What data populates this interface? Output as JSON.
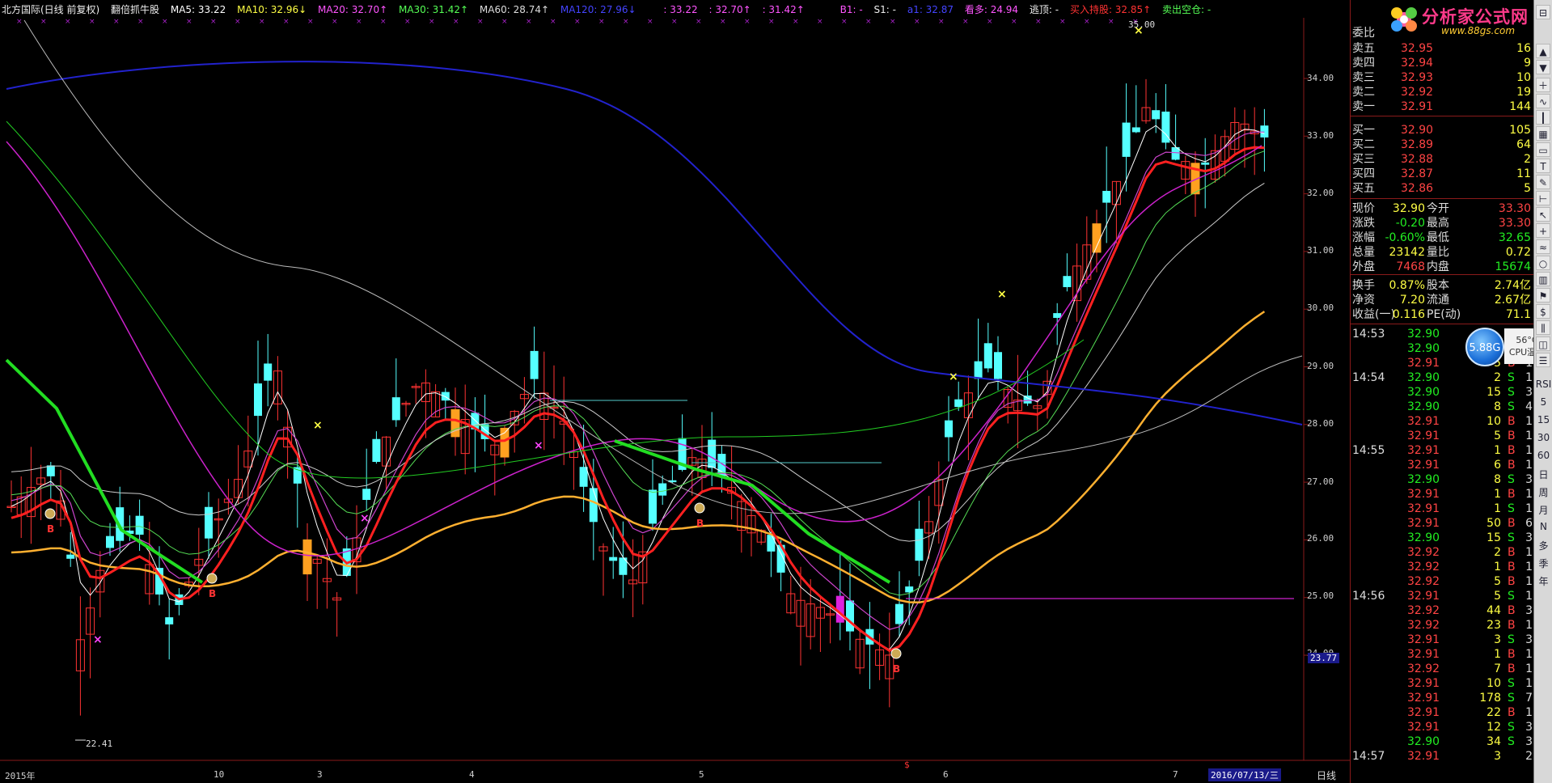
{
  "legend": {
    "title": "北方国际(日线 前复权)",
    "indicator": "翻倍抓牛股",
    "ma5": "MA5: 33.22",
    "ma10": "MA10: 32.96↓",
    "ma20": "MA20: 32.70↑",
    "ma30": "MA30: 31.42↑",
    "ma60": "MA60: 28.74↑",
    "ma120": "MA120: 27.96↓",
    "v1": ": 33.22",
    "v2": ": 32.70↑",
    "v3": ": 31.42↑",
    "b1": "B1: -",
    "s1": "S1: -",
    "a1": "a1: 32.87",
    "kanduo": "看多: 24.94",
    "taoding": "逃顶: -",
    "mairu": "买入持股: 32.85↑",
    "maichu": "卖出空仓: -"
  },
  "colors": {
    "ma5": "#ffffff",
    "ma10": "#ffff00",
    "ma20": "#ff44ff",
    "ma30": "#44ff44",
    "ma60": "#dddddd",
    "ma120": "#2222cc",
    "up": "#ff3333",
    "down": "#55ffff",
    "red_line": "#ff2020",
    "green_line": "#22dd22",
    "orange_line": "#ffb030",
    "magenta": "#dd22dd"
  },
  "price_axis": [
    "34.00",
    "33.00",
    "32.00",
    "31.00",
    "30.00",
    "29.00",
    "28.00",
    "27.00",
    "26.00",
    "25.00",
    "24.00"
  ],
  "price_marker": "23.77",
  "annotations": {
    "high": "35.00",
    "low": "22.41"
  },
  "date_axis": [
    "2015年",
    "10",
    "3",
    "4",
    "5",
    "6",
    "7"
  ],
  "current_date": "2016/07/13/三",
  "period_label": "日线",
  "logo": {
    "main": "分析家公式网",
    "url": "www.88gs.com"
  },
  "badge": "5.88G",
  "cpu": {
    "temp": "56°C",
    "label": "CPU温度"
  },
  "order_book": {
    "weibi_label": "委比",
    "asks": [
      {
        "label": "卖五",
        "price": "32.95",
        "vol": "16"
      },
      {
        "label": "卖四",
        "price": "32.94",
        "vol": "9"
      },
      {
        "label": "卖三",
        "price": "32.93",
        "vol": "10"
      },
      {
        "label": "卖二",
        "price": "32.92",
        "vol": "19"
      },
      {
        "label": "卖一",
        "price": "32.91",
        "vol": "144"
      }
    ],
    "bids": [
      {
        "label": "买一",
        "price": "32.90",
        "vol": "105"
      },
      {
        "label": "买二",
        "price": "32.89",
        "vol": "64"
      },
      {
        "label": "买三",
        "price": "32.88",
        "vol": "2"
      },
      {
        "label": "买四",
        "price": "32.87",
        "vol": "11"
      },
      {
        "label": "买五",
        "price": "32.86",
        "vol": "5"
      }
    ]
  },
  "quote": [
    {
      "l1": "现价",
      "v1": "32.90",
      "l2": "今开",
      "v2": "33.30"
    },
    {
      "l1": "涨跌",
      "v1": "-0.20",
      "l2": "最高",
      "v2": "33.30"
    },
    {
      "l1": "涨幅",
      "v1": "-0.60%",
      "l2": "最低",
      "v2": "32.65"
    },
    {
      "l1": "总量",
      "v1": "23142",
      "l2": "量比",
      "v2": "0.72"
    },
    {
      "l1": "外盘",
      "v1": "7468",
      "l2": "内盘",
      "v2": "15674"
    }
  ],
  "stats": [
    {
      "l1": "换手",
      "v1": "0.87%",
      "l2": "股本",
      "v2": "2.74亿"
    },
    {
      "l1": "净资",
      "v1": "7.20",
      "l2": "流通",
      "v2": "2.67亿"
    },
    {
      "l1": "收益(一)",
      "v1": "0.116",
      "l2": "PE(动)",
      "v2": "71.1"
    }
  ],
  "ticks": [
    {
      "time": "14:53",
      "price": "32.90",
      "vol": "",
      "bs": "",
      "n": ""
    },
    {
      "time": "",
      "price": "32.90",
      "vol": "",
      "bs": "",
      "n": ""
    },
    {
      "time": "",
      "price": "32.91",
      "vol": "5",
      "bs": "B",
      "n": "1"
    },
    {
      "time": "14:54",
      "price": "32.90",
      "vol": "2",
      "bs": "S",
      "n": "1"
    },
    {
      "time": "",
      "price": "32.90",
      "vol": "15",
      "bs": "S",
      "n": "3"
    },
    {
      "time": "",
      "price": "32.90",
      "vol": "8",
      "bs": "S",
      "n": "4"
    },
    {
      "time": "",
      "price": "32.91",
      "vol": "10",
      "bs": "B",
      "n": "1"
    },
    {
      "time": "",
      "price": "32.91",
      "vol": "5",
      "bs": "B",
      "n": "1"
    },
    {
      "time": "14:55",
      "price": "32.91",
      "vol": "1",
      "bs": "B",
      "n": "1"
    },
    {
      "time": "",
      "price": "32.91",
      "vol": "6",
      "bs": "B",
      "n": "1"
    },
    {
      "time": "",
      "price": "32.90",
      "vol": "8",
      "bs": "S",
      "n": "3"
    },
    {
      "time": "",
      "price": "32.91",
      "vol": "1",
      "bs": "B",
      "n": "1"
    },
    {
      "time": "",
      "price": "32.91",
      "vol": "1",
      "bs": "S",
      "n": "1"
    },
    {
      "time": "",
      "price": "32.91",
      "vol": "50",
      "bs": "B",
      "n": "6"
    },
    {
      "time": "",
      "price": "32.90",
      "vol": "15",
      "bs": "S",
      "n": "3"
    },
    {
      "time": "",
      "price": "32.92",
      "vol": "2",
      "bs": "B",
      "n": "1"
    },
    {
      "time": "",
      "price": "32.92",
      "vol": "1",
      "bs": "B",
      "n": "1"
    },
    {
      "time": "",
      "price": "32.92",
      "vol": "5",
      "bs": "B",
      "n": "1"
    },
    {
      "time": "14:56",
      "price": "32.91",
      "vol": "5",
      "bs": "S",
      "n": "1"
    },
    {
      "time": "",
      "price": "32.92",
      "vol": "44",
      "bs": "B",
      "n": "3"
    },
    {
      "time": "",
      "price": "32.92",
      "vol": "23",
      "bs": "B",
      "n": "1"
    },
    {
      "time": "",
      "price": "32.91",
      "vol": "3",
      "bs": "S",
      "n": "3"
    },
    {
      "time": "",
      "price": "32.91",
      "vol": "1",
      "bs": "B",
      "n": "1"
    },
    {
      "time": "",
      "price": "32.92",
      "vol": "7",
      "bs": "B",
      "n": "1"
    },
    {
      "time": "",
      "price": "32.91",
      "vol": "10",
      "bs": "S",
      "n": "1"
    },
    {
      "time": "",
      "price": "32.91",
      "vol": "178",
      "bs": "S",
      "n": "7"
    },
    {
      "time": "",
      "price": "32.91",
      "vol": "22",
      "bs": "B",
      "n": "1"
    },
    {
      "time": "",
      "price": "32.91",
      "vol": "12",
      "bs": "S",
      "n": "3"
    },
    {
      "time": "",
      "price": "32.90",
      "vol": "34",
      "bs": "S",
      "n": "3"
    },
    {
      "time": "14:57",
      "price": "32.91",
      "vol": "3",
      "bs": "",
      "n": "2"
    }
  ],
  "toolbar_text": [
    "RSI",
    "5",
    "15",
    "30",
    "60",
    "日",
    "周",
    "月",
    "N",
    "多",
    "季",
    "年"
  ]
}
